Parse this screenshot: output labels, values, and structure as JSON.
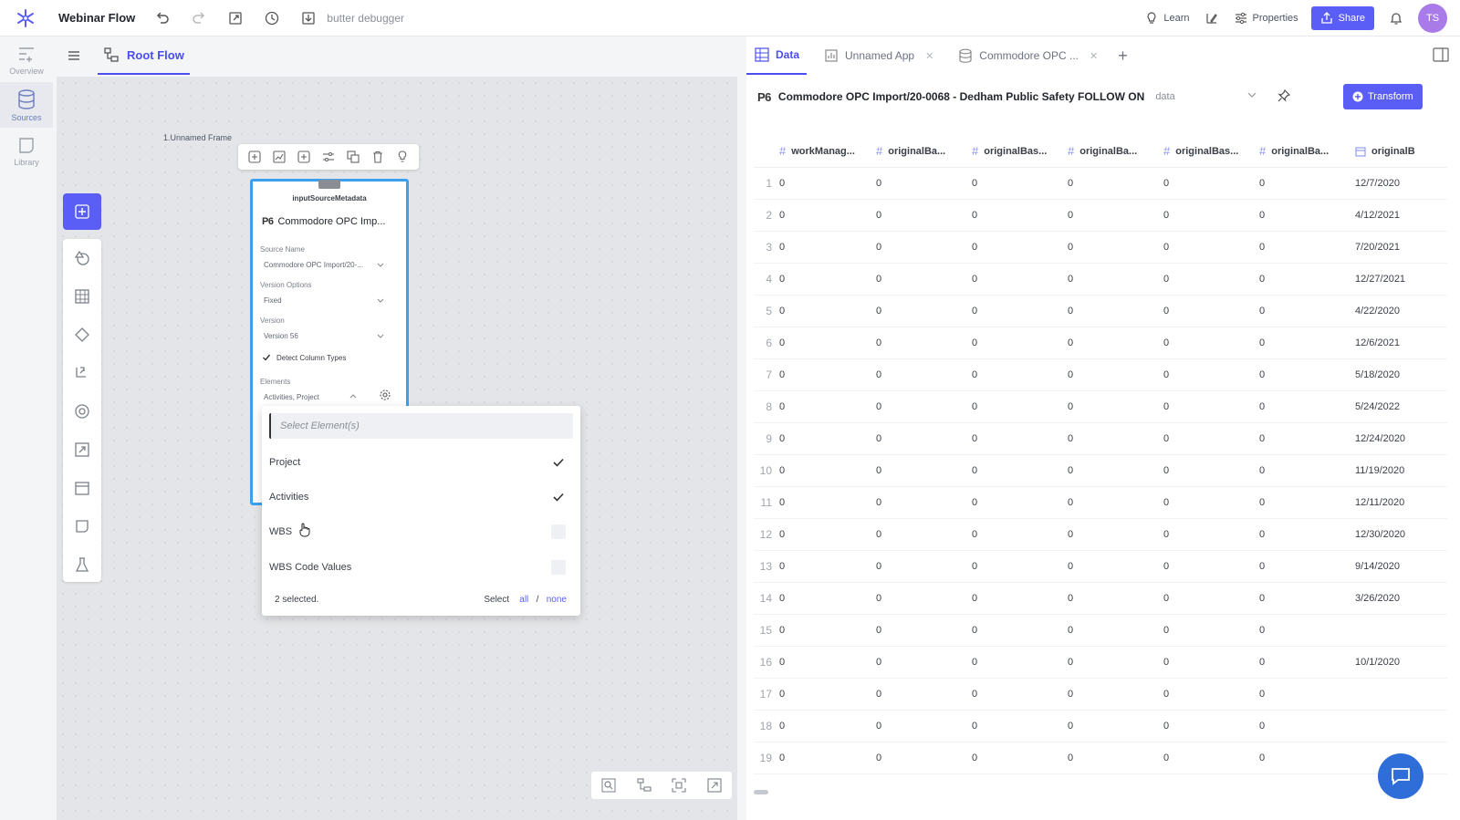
{
  "app": {
    "title": "Webinar Flow",
    "debugger": "butter debugger",
    "avatar": "TS",
    "accent": "#5b5ef6"
  },
  "topbar": {
    "learn": "Learn",
    "properties": "Properties",
    "share": "Share"
  },
  "rail": {
    "overview": "Overview",
    "sources": "Sources",
    "library": "Library"
  },
  "left": {
    "tab": "Root Flow",
    "frame_label": "1.Unnamed Frame"
  },
  "node": {
    "metadata_label": "inputSourceMetadata",
    "p6": "P6",
    "title": "Commodore OPC Imp...",
    "source_name_label": "Source Name",
    "source_name_value": "Commodore OPC Import/20-...",
    "version_options_label": "Version Options",
    "version_options_value": "Fixed",
    "version_label": "Version",
    "version_value": "Version 56",
    "detect_label": "Detect Column Types",
    "elements_label": "Elements",
    "elements_value": "Activities, Project"
  },
  "dropdown": {
    "placeholder": "Select Element(s)",
    "options": [
      {
        "label": "Project",
        "checked": true
      },
      {
        "label": "Activities",
        "checked": true
      },
      {
        "label": "WBS",
        "checked": false
      },
      {
        "label": "WBS Code Values",
        "checked": false
      }
    ],
    "selected_text": "2 selected.",
    "select_label": "Select",
    "all": "all",
    "slash": "/",
    "none": "none"
  },
  "right": {
    "tabs": [
      {
        "label": "Data",
        "active": true
      },
      {
        "label": "Unnamed App",
        "active": false
      },
      {
        "label": "Commodore OPC ...",
        "active": false
      }
    ],
    "p6": "P6",
    "data_title": "Commodore OPC Import/20-0068 - Dedham Public Safety FOLLOW ON",
    "data_sub": "data",
    "transform": "Transform"
  },
  "grid": {
    "headers": [
      "workManag...",
      "originalBa...",
      "originalBas...",
      "originalBa...",
      "originalBas...",
      "originalBa...",
      "originalB"
    ],
    "rows": [
      [
        "1",
        "0",
        "0",
        "0",
        "0",
        "0",
        "0",
        "12/7/2020"
      ],
      [
        "2",
        "0",
        "0",
        "0",
        "0",
        "0",
        "0",
        "4/12/2021"
      ],
      [
        "3",
        "0",
        "0",
        "0",
        "0",
        "0",
        "0",
        "7/20/2021"
      ],
      [
        "4",
        "0",
        "0",
        "0",
        "0",
        "0",
        "0",
        "12/27/2021"
      ],
      [
        "5",
        "0",
        "0",
        "0",
        "0",
        "0",
        "0",
        "4/22/2020"
      ],
      [
        "6",
        "0",
        "0",
        "0",
        "0",
        "0",
        "0",
        "12/6/2021"
      ],
      [
        "7",
        "0",
        "0",
        "0",
        "0",
        "0",
        "0",
        "5/18/2020"
      ],
      [
        "8",
        "0",
        "0",
        "0",
        "0",
        "0",
        "0",
        "5/24/2022"
      ],
      [
        "9",
        "0",
        "0",
        "0",
        "0",
        "0",
        "0",
        "12/24/2020"
      ],
      [
        "10",
        "0",
        "0",
        "0",
        "0",
        "0",
        "0",
        "11/19/2020"
      ],
      [
        "11",
        "0",
        "0",
        "0",
        "0",
        "0",
        "0",
        "12/11/2020"
      ],
      [
        "12",
        "0",
        "0",
        "0",
        "0",
        "0",
        "0",
        "12/30/2020"
      ],
      [
        "13",
        "0",
        "0",
        "0",
        "0",
        "0",
        "0",
        "9/14/2020"
      ],
      [
        "14",
        "0",
        "0",
        "0",
        "0",
        "0",
        "0",
        "3/26/2020"
      ],
      [
        "15",
        "0",
        "0",
        "0",
        "0",
        "0",
        "0",
        ""
      ],
      [
        "16",
        "0",
        "0",
        "0",
        "0",
        "0",
        "0",
        "10/1/2020"
      ],
      [
        "17",
        "0",
        "0",
        "0",
        "0",
        "0",
        "0",
        ""
      ],
      [
        "18",
        "0",
        "0",
        "0",
        "0",
        "0",
        "0",
        ""
      ],
      [
        "19",
        "0",
        "0",
        "0",
        "0",
        "0",
        "0",
        ""
      ]
    ]
  }
}
